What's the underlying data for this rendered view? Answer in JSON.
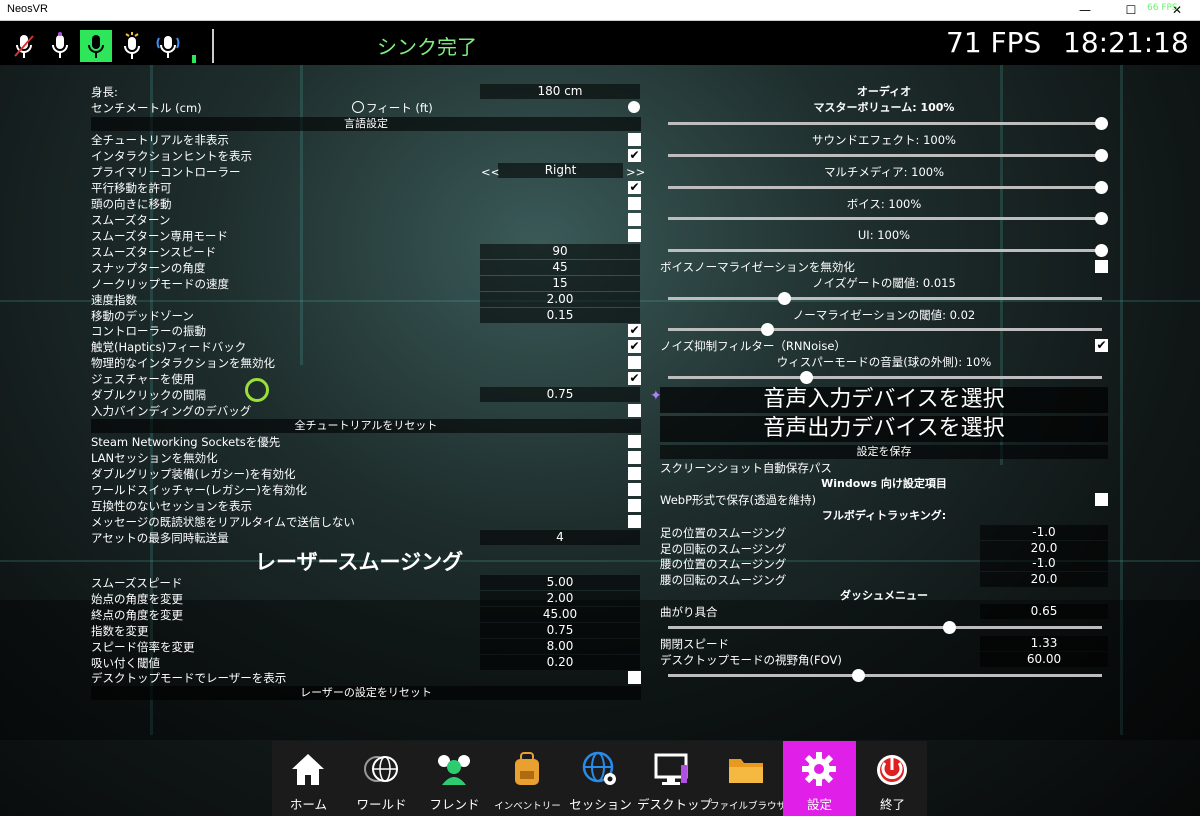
{
  "window": {
    "title": "NeosVR",
    "minimize": "—",
    "maximize": "☐",
    "close": "✕"
  },
  "topbar": {
    "sync_status": "シンク完了",
    "fps": "71 FPS",
    "clock": "18:21:18",
    "fps_small": "66 FPS"
  },
  "left": {
    "height_label": "身長:",
    "height_value": "180 cm",
    "unit_cm": "センチメートル (cm)",
    "unit_ft": "フィート (ft)",
    "lang": "言語設定",
    "opt_hide_tut": "全チュートリアルを非表示",
    "opt_hints": "インタラクションヒントを表示",
    "primary_ctrl": "プライマリーコントローラー",
    "prim_prev": "<<",
    "primary_value": "Right",
    "prim_next": ">>",
    "opt_translate": "平行移動を許可",
    "opt_headmove": "頭の向きに移動",
    "opt_smoothturn": "スムーズターン",
    "opt_smoothonly": "スムーズターン専用モード",
    "smooth_speed": "スムーズターンスピード",
    "smooth_speed_v": "90",
    "snap_angle": "スナップターンの角度",
    "snap_angle_v": "45",
    "noclip": "ノークリップモードの速度",
    "noclip_v": "15",
    "speed_exp": "速度指数",
    "speed_exp_v": "2.00",
    "deadzone": "移動のデッドゾーン",
    "deadzone_v": "0.15",
    "vibration": "コントローラーの振動",
    "haptics": "触覚(Haptics)フィードバック",
    "physical": "物理的なインタラクションを無効化",
    "gestures": "ジェスチャーを使用",
    "dblclick": "ダブルクリックの間隔",
    "dblclick_v": "0.75",
    "binddebug": "入力バインディングのデバッグ",
    "reset_tut": "全チュートリアルをリセット",
    "steam": "Steam Networking Socketsを優先",
    "lan": "LANセッションを無効化",
    "dblgrip": "ダブルグリップ装備(レガシー)を有効化",
    "worldsw": "ワールドスイッチャー(レガシー)を有効化",
    "incompat": "互換性のないセッションを表示",
    "readstate": "メッセージの既読状態をリアルタイムで送信しない",
    "assets": "アセットの最多同時転送量",
    "assets_v": "4",
    "laser_title": "レーザースムージング",
    "l_speed": "スムーズスピード",
    "l_speed_v": "5.00",
    "l_start": "始点の角度を変更",
    "l_start_v": "2.00",
    "l_end": "終点の角度を変更",
    "l_end_v": "45.00",
    "l_exp": "指数を変更",
    "l_exp_v": "0.75",
    "l_mult": "スピード倍率を変更",
    "l_mult_v": "8.00",
    "l_snap": "吸い付く閾値",
    "l_snap_v": "0.20",
    "l_desktop": "デスクトップモードでレーザーを表示",
    "l_reset": "レーザーの設定をリセット"
  },
  "right": {
    "audio": "オーディオ",
    "master": "マスターボリューム: 100%",
    "sfx": "サウンドエフェクト: 100%",
    "multimedia": "マルチメディア: 100%",
    "voice": "ボイス: 100%",
    "ui": "UI: 100%",
    "voice_norm": "ボイスノーマライゼーションを無効化",
    "noise_gate": "ノイズゲートの閾値: 0.015",
    "norm_thr": "ノーマライゼーションの閾値: 0.02",
    "rnnoise": "ノイズ抑制フィルター（RNNoise）",
    "whisper": "ウィスパーモードの音量(球の外側): 10%",
    "input_dev": "音声入力デバイスを選択",
    "output_dev": "音声出力デバイスを選択",
    "save": "設定を保存",
    "screenshot": "スクリーンショット自動保存パス",
    "windows": "Windows 向け設定項目",
    "webp": "WebP形式で保存(透過を維持)",
    "fbt": "フルボディトラッキング:",
    "foot_pos": "足の位置のスムージング",
    "foot_pos_v": "-1.0",
    "foot_rot": "足の回転のスムージング",
    "foot_rot_v": "20.0",
    "hip_pos": "腰の位置のスムージング",
    "hip_pos_v": "-1.0",
    "hip_rot": "腰の回転のスムージング",
    "hip_rot_v": "20.0",
    "dash": "ダッシュメニュー",
    "curve": "曲がり具合",
    "curve_v": "0.65",
    "open_speed": "開閉スピード",
    "open_speed_v": "1.33",
    "fov": "デスクトップモードの視野角(FOV)",
    "fov_v": "60.00"
  },
  "sliders": {
    "master": 1.0,
    "sfx": 1.0,
    "multimedia": 1.0,
    "voice": 1.0,
    "ui": 1.0,
    "noise_gate": 0.27,
    "norm_thr": 0.23,
    "whisper": 0.32,
    "curve": 0.65,
    "fov": 0.44
  },
  "dock": [
    {
      "label": "ホーム",
      "icon": "home-icon"
    },
    {
      "label": "ワールド",
      "icon": "worlds-icon"
    },
    {
      "label": "フレンド",
      "icon": "friends-icon"
    },
    {
      "label": "インベントリー",
      "icon": "inventory-icon"
    },
    {
      "label": "セッション",
      "icon": "session-icon"
    },
    {
      "label": "デスクトップ",
      "icon": "desktop-icon"
    },
    {
      "label": "ファイルブラウザ",
      "icon": "folder-icon"
    },
    {
      "label": "設定",
      "icon": "gear-icon"
    },
    {
      "label": "終了",
      "icon": "power-icon"
    }
  ]
}
